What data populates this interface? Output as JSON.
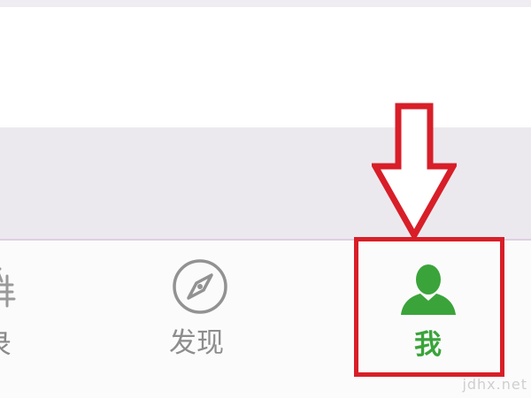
{
  "tabbar": {
    "tabs": [
      {
        "id": "contacts",
        "label": "通讯录",
        "visible_text_top": "乍",
        "visible_text": "录",
        "icon": "contacts-icon",
        "active": false
      },
      {
        "id": "discover",
        "label": "发现",
        "icon": "compass-icon",
        "active": false
      },
      {
        "id": "me",
        "label": "我",
        "icon": "person-icon",
        "active": true
      }
    ]
  },
  "annotation": {
    "arrow": "down-arrow",
    "highlight": "me-tab"
  },
  "colors": {
    "active": "#3aa43a",
    "inactive": "#8d8d8d",
    "annotation": "#d81e28",
    "band": "#ece9ee"
  },
  "watermark": "jdhx.net"
}
